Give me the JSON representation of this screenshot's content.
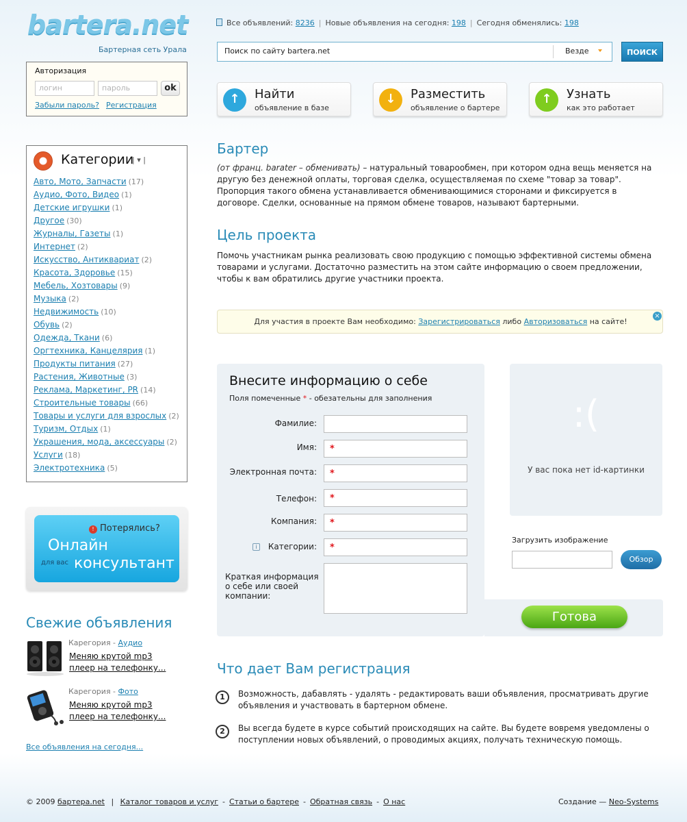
{
  "brand": {
    "logo_text": "bartera.net",
    "tagline": "Бартерная сеть Урала"
  },
  "auth": {
    "title": "Авторизация",
    "login_placeholder": "логин",
    "password_placeholder": "пароль",
    "submit_label": "ok",
    "forgot_label": "Забыли пароль?",
    "register_label": "Регистрация"
  },
  "categories": {
    "title": "Категории",
    "items": [
      {
        "label": "Авто, Мото, Запчасти",
        "count": "(17)"
      },
      {
        "label": "Аудио, Фото, Видео",
        "count": "(1)"
      },
      {
        "label": "Детские игрушки",
        "count": "(1)"
      },
      {
        "label": "Другое",
        "count": "(30)"
      },
      {
        "label": "Журналы, Газеты",
        "count": "(1)"
      },
      {
        "label": "Интернет",
        "count": "(2)"
      },
      {
        "label": "Искусство, Антиквариат",
        "count": "(2)"
      },
      {
        "label": "Красота, Здоровье",
        "count": "(15)"
      },
      {
        "label": "Мебель, Хозтовары",
        "count": "(9)"
      },
      {
        "label": "Музыка",
        "count": "(2)"
      },
      {
        "label": "Недвижимость",
        "count": "(10)"
      },
      {
        "label": "Обувь",
        "count": "(2)"
      },
      {
        "label": "Одежда, Ткани",
        "count": "(6)"
      },
      {
        "label": "Оргтехника, Канцелярия",
        "count": "(1)"
      },
      {
        "label": "Продукты питания",
        "count": "(27)"
      },
      {
        "label": "Растения, Животные",
        "count": "(3)"
      },
      {
        "label": "Реклама, Маркетинг, PR",
        "count": "(14)"
      },
      {
        "label": "Строительные товары",
        "count": "(66)"
      },
      {
        "label": "Товары и услуги для взрослых",
        "count": "(2)"
      },
      {
        "label": "Туризм, Отдых",
        "count": "(1)"
      },
      {
        "label": "Украшения, мода, аксессуары",
        "count": "(2)"
      },
      {
        "label": "Услуги",
        "count": "(18)"
      },
      {
        "label": "Электротехника",
        "count": "(5)"
      }
    ]
  },
  "consultant": {
    "lost_label": "Потерялись?",
    "line1": "Онлайн",
    "for_you": "для вас",
    "line2": "консультант"
  },
  "fresh": {
    "title": "Свежие объявления",
    "items": [
      {
        "cat_prefix": "Карегория - ",
        "cat_link": "Аудио",
        "line1": "Меняю крутой mp3",
        "line2": "плеер на телефонку..."
      },
      {
        "cat_prefix": "Карегория - ",
        "cat_link": "Фото",
        "line1": "Меняю крутой mp3",
        "line2": "плеер на телефонку..."
      }
    ],
    "all_link": "Все объявления на сегодня..."
  },
  "stats": {
    "total_label": "Все объявлений:",
    "total_value": "8236",
    "new_label": "Новые объявления на сегодня:",
    "new_value": "198",
    "exchanged_label": "Сегодня обменялись:",
    "exchanged_value": "198"
  },
  "search": {
    "placeholder": "Поиск по сайту bartera.net",
    "scope": "Везде",
    "button": "ПОИСК"
  },
  "actions": [
    {
      "title": "Найти",
      "subtitle": "объявление в базе",
      "color": "#2ea8dd"
    },
    {
      "title": "Разместить",
      "subtitle": "объявление о бартере",
      "color": "#f2b10f"
    },
    {
      "title": "Узнать",
      "subtitle": "как это работает",
      "color": "#7fcc1f"
    }
  ],
  "barter": {
    "title": "Бартер",
    "italic": "(от франц. barater – обменивать)",
    "text": " – натуральный товарообмен, при котором одна вещь меняется на другую без денежной оплаты, торговая сделка, осуществляемая по схеме \"товар за товар\". Пропорция такого обмена устанавливается обменивающимися сторонами и фиксируется в договоре. Сделки, основанные на прямом обмене товаров, называют бартерными."
  },
  "goal": {
    "title": "Цель проекта",
    "text": "Помочь участникам рынка реализовать свою продукцию с помощью эффективной системы обмена товарами и услугами. Достаточно разместить на этом сайте информацию о своем предложении, чтобы к вам обратились другие участники проекта."
  },
  "notice": {
    "prefix": "Для участия в проекте Вам необходимо: ",
    "register": "Зарегистрироваться",
    "middle": " либо ",
    "login": "Авторизоваться",
    "suffix": " на сайте!"
  },
  "form": {
    "title": "Внесите информацию о себе",
    "note_prefix": "Поля помеченные ",
    "note_star": "*",
    "note_suffix": " - обезательны для заполнения",
    "fields": {
      "lastname": "Фамилие:",
      "firstname": "Имя:",
      "email": "Электронная почта:",
      "phone": "Телефон:",
      "company": "Компания:",
      "categories": "Категории:",
      "about": "Краткая информация о себе или своей компании:"
    },
    "required_mark": "*",
    "submit": "Готова"
  },
  "idpicture": {
    "face": ":(",
    "text": "У вас пока нет id-картинки",
    "upload_label": "Загрузить изображение",
    "browse": "Обзор"
  },
  "benefits": {
    "title": "Что дает Вам регистрация",
    "items": [
      {
        "num": "1",
        "text": "Возможность, дабавлять - удалять - редактировать ваши объявления, просматривать другие объявления и участвовать в бартерном обмене."
      },
      {
        "num": "2",
        "text": "Вы всегда будете в курсе событий происходящих на сайте. Вы будете вовремя уведомлены о поступлении новых объявлений, о проводимых акциях, получать техническую помощь."
      }
    ]
  },
  "footer": {
    "copyright": "© 2009",
    "site_link": "бартера.net",
    "links": [
      "Каталог товаров и услуг",
      "Статьи о бартере",
      "Обратная связь",
      "О нас"
    ],
    "created_label": "Создание — ",
    "created_link": "Neo-Systems"
  }
}
